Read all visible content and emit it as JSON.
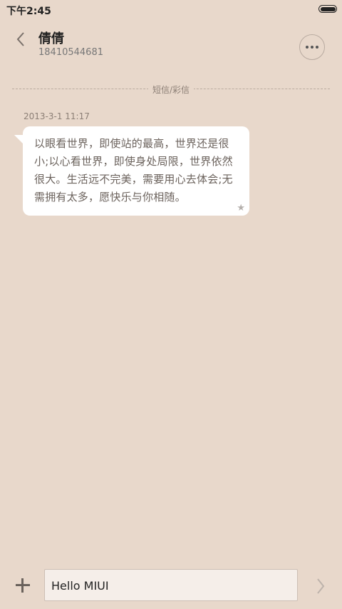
{
  "status_bar": {
    "time": "下午2:45",
    "battery_level": 1.0
  },
  "header": {
    "contact_name": "倩倩",
    "contact_number": "18410544681",
    "back_icon": "chevron-left-icon",
    "more_icon": "more-horizontal-icon"
  },
  "conversation": {
    "divider_label": "短信/彩信",
    "messages": [
      {
        "timestamp": "2013-3-1 11:17",
        "text": "以眼看世界，即使站的最高，世界还是很小;以心看世界，即使身处局限，世界依然很大。生活远不完美，需要用心去体会;无需拥有太多，愿快乐与你相随。",
        "starred": true
      }
    ]
  },
  "composer": {
    "input_value": "Hello MIUI",
    "add_icon": "plus-icon",
    "send_icon": "chevron-right-icon"
  },
  "colors": {
    "background": "#e8d8cb",
    "bubble": "#ffffff",
    "input_background": "#f5eee9"
  }
}
